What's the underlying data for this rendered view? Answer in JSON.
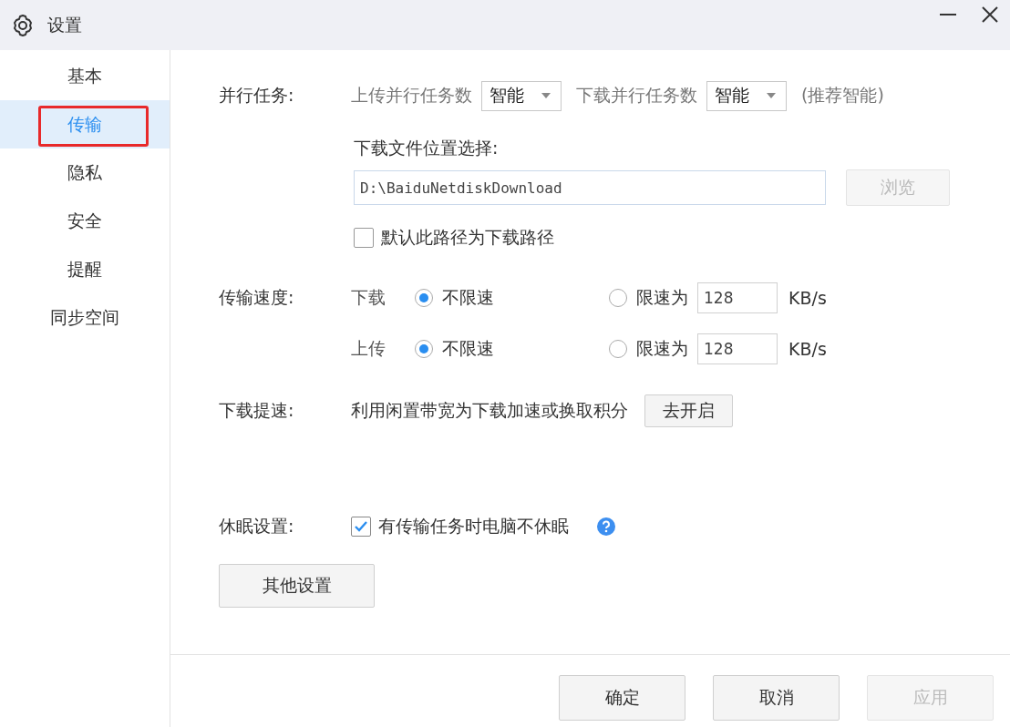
{
  "window": {
    "title": "设置"
  },
  "sidebar": {
    "items": [
      {
        "label": "基本",
        "selected": false,
        "annotated": false
      },
      {
        "label": "传输",
        "selected": true,
        "annotated": true
      },
      {
        "label": "隐私",
        "selected": false,
        "annotated": false
      },
      {
        "label": "安全",
        "selected": false,
        "annotated": false
      },
      {
        "label": "提醒",
        "selected": false,
        "annotated": false
      },
      {
        "label": "同步空间",
        "selected": false,
        "annotated": false
      }
    ]
  },
  "parallel": {
    "label": "并行任务:",
    "upload_label": "上传并行任务数",
    "upload_value": "智能",
    "download_label": "下载并行任务数",
    "download_value": "智能",
    "hint": "(推荐智能)"
  },
  "location": {
    "label": "下载文件位置选择:",
    "path": "D:\\BaiduNetdiskDownload",
    "browse": {
      "label": "浏览",
      "disabled": true
    },
    "default_checkbox": {
      "label": "默认此路径为下载路径",
      "checked": false
    }
  },
  "speed": {
    "label": "传输速度:",
    "rows": [
      {
        "direction": "下载",
        "options": [
          {
            "label": "不限速",
            "selected": true
          },
          {
            "label": "限速为",
            "selected": false
          }
        ],
        "limit": "128",
        "unit": "KB/s"
      },
      {
        "direction": "上传",
        "options": [
          {
            "label": "不限速",
            "selected": true
          },
          {
            "label": "限速为",
            "selected": false
          }
        ],
        "limit": "128",
        "unit": "KB/s"
      }
    ]
  },
  "boost": {
    "label": "下载提速:",
    "text": "利用闲置带宽为下载加速或换取积分",
    "button": "去开启"
  },
  "sleep": {
    "label": "休眠设置:",
    "checkbox": {
      "label": "有传输任务时电脑不休眠",
      "checked": true
    }
  },
  "other_button": "其他设置",
  "footer": {
    "buttons": [
      {
        "label": "确定",
        "disabled": false
      },
      {
        "label": "取消",
        "disabled": false
      },
      {
        "label": "应用",
        "disabled": true
      }
    ]
  }
}
